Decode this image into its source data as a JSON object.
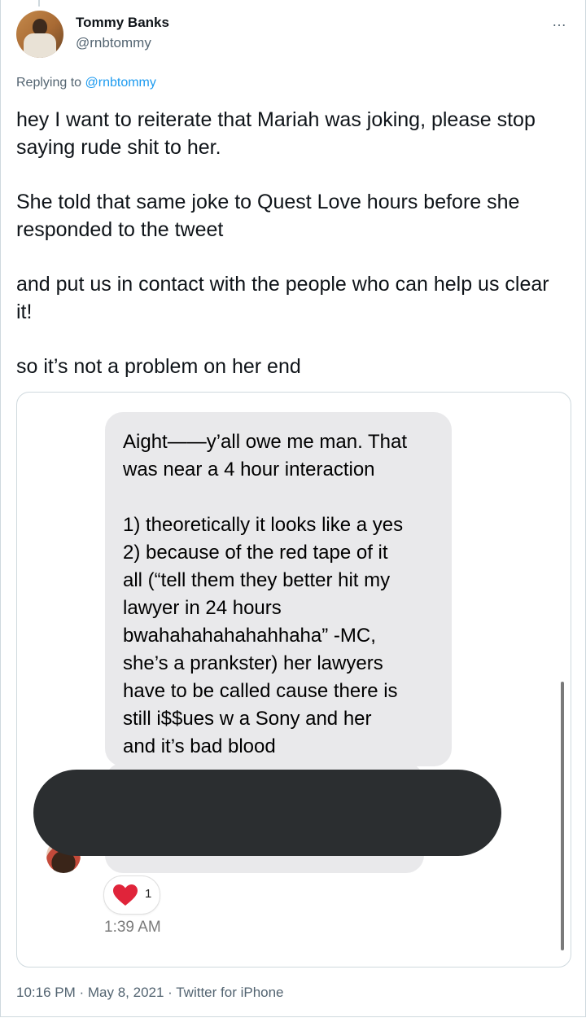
{
  "author": {
    "name": "Tommy Banks",
    "handle": "@rnbtommy"
  },
  "more_icon": "…",
  "reply": {
    "prefix": "Replying to",
    "to": "@rnbtommy"
  },
  "tweet": {
    "paragraphs": [
      "hey I want to reiterate that Mariah was joking, please stop saying rude shit to her.",
      "She told that same joke to Quest Love hours before she responded to the tweet",
      "and put us in contact with the people who can help us clear it!",
      "so it’s not a problem on her end"
    ]
  },
  "screenshot": {
    "lines_a": [
      "Aight——y’all owe me man. That",
      "was near a 4 hour interaction"
    ],
    "lines_b": [
      "1) theoretically it looks like a yes",
      "2) because of the red tape of it",
      "all (“tell them they better hit my",
      "lawyer in 24 hours",
      "bwahahahahahahhaha” -MC,",
      "she’s a prankster) her lawyers",
      "have to be called cause there is",
      "still i$$ues w a Sony and her",
      "and it’s bad blood"
    ],
    "reaction": {
      "icon": "heart-icon",
      "count": "1",
      "color": "#e0243a"
    },
    "time": "1:39 AM"
  },
  "footer": {
    "text": "10:16 PM · May 8, 2021 · Twitter for iPhone"
  }
}
